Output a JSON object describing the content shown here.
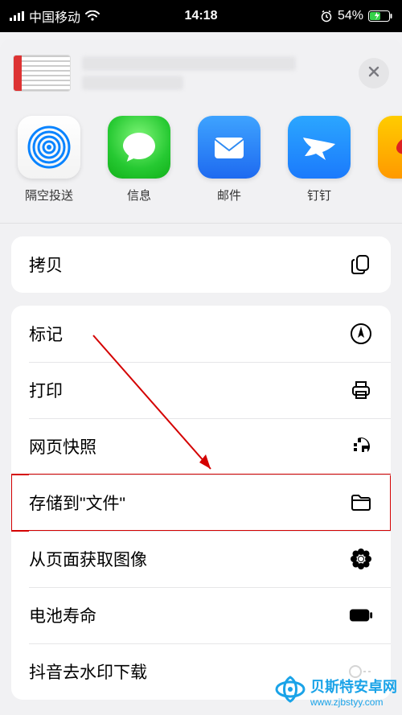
{
  "status": {
    "carrier": "中国移动",
    "time": "14:18",
    "battery_pct": "54%"
  },
  "share_apps": [
    {
      "id": "airdrop",
      "label": "隔空投送"
    },
    {
      "id": "messages",
      "label": "信息"
    },
    {
      "id": "mail",
      "label": "邮件"
    },
    {
      "id": "dingtalk",
      "label": "钉钉"
    }
  ],
  "actions": {
    "copy": "拷贝",
    "markup": "标记",
    "print": "打印",
    "websnap": "网页快照",
    "savefiles": "存储到\"文件\"",
    "getimage": "从页面获取图像",
    "battery": "电池寿命",
    "douyin": "抖音去水印下载"
  },
  "watermark": {
    "name": "贝斯特安卓网",
    "url": "www.zjbstyy.com"
  }
}
